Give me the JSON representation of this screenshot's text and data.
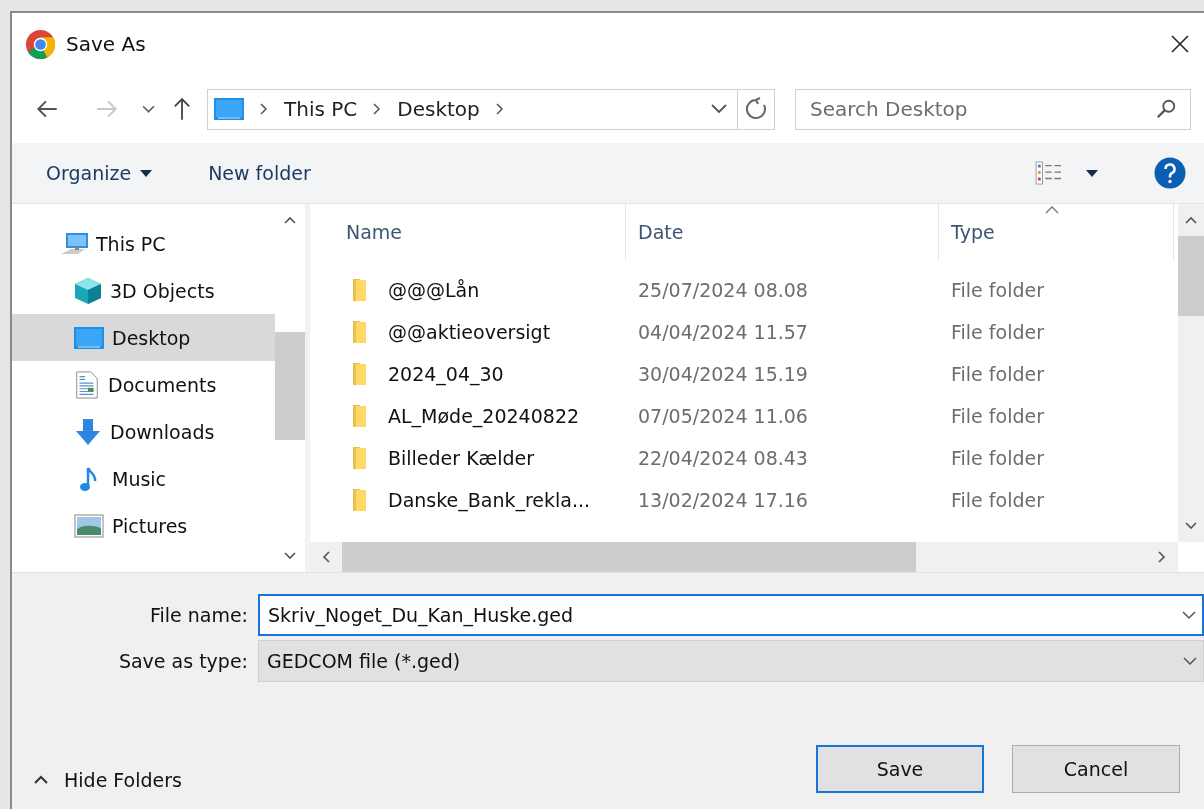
{
  "window": {
    "title": "Save As"
  },
  "navigation": {
    "back_disabled": false,
    "forward_disabled": true,
    "breadcrumb": [
      "This PC",
      "Desktop"
    ]
  },
  "search": {
    "placeholder": "Search Desktop"
  },
  "toolbar": {
    "buttons": [
      {
        "label": "Organize",
        "kind": "menu"
      },
      {
        "label": "New folder",
        "kind": "plain"
      }
    ]
  },
  "sidebar": {
    "items": [
      {
        "label": "This PC",
        "kind": "pc",
        "selected": false,
        "children": [
          {
            "label": "3D Objects",
            "kind": "cube",
            "selected": false
          },
          {
            "label": "Desktop",
            "kind": "desktop",
            "selected": true
          },
          {
            "label": "Documents",
            "kind": "documents",
            "selected": false
          },
          {
            "label": "Downloads",
            "kind": "downloads",
            "selected": false
          },
          {
            "label": "Music",
            "kind": "music",
            "selected": false
          },
          {
            "label": "Pictures",
            "kind": "pictures",
            "selected": false
          }
        ]
      }
    ]
  },
  "file_list": {
    "columns": [
      {
        "label": "Name",
        "sorted": false
      },
      {
        "label": "Date",
        "sorted": false
      },
      {
        "label": "Type",
        "sorted": true
      }
    ],
    "rows": [
      {
        "name": "@@@Lån",
        "date": "25/07/2024 08.08",
        "type": "File folder"
      },
      {
        "name": "@@aktieoversigt",
        "date": "04/04/2024 11.57",
        "type": "File folder"
      },
      {
        "name": "2024_04_30",
        "date": "30/04/2024 15.19",
        "type": "File folder"
      },
      {
        "name": "AL_Møde_20240822",
        "date": "07/05/2024 11.06",
        "type": "File folder"
      },
      {
        "name": "Billeder Kælder",
        "date": "22/04/2024 08.43",
        "type": "File folder"
      },
      {
        "name": "Danske_Bank_rekla...",
        "date": "13/02/2024 17.16",
        "type": "File folder"
      }
    ]
  },
  "form": {
    "file_name": {
      "label": "File name:",
      "value": "Skriv_Noget_Du_Kan_Huske.ged",
      "focused": true
    },
    "save_as_type": {
      "label": "Save as type:",
      "value": "GEDCOM file (*.ged)",
      "focused": false
    }
  },
  "hide_folders": {
    "label": "Hide Folders"
  },
  "buttons": [
    {
      "label": "Save",
      "default": true
    },
    {
      "label": "Cancel",
      "default": false
    }
  ]
}
